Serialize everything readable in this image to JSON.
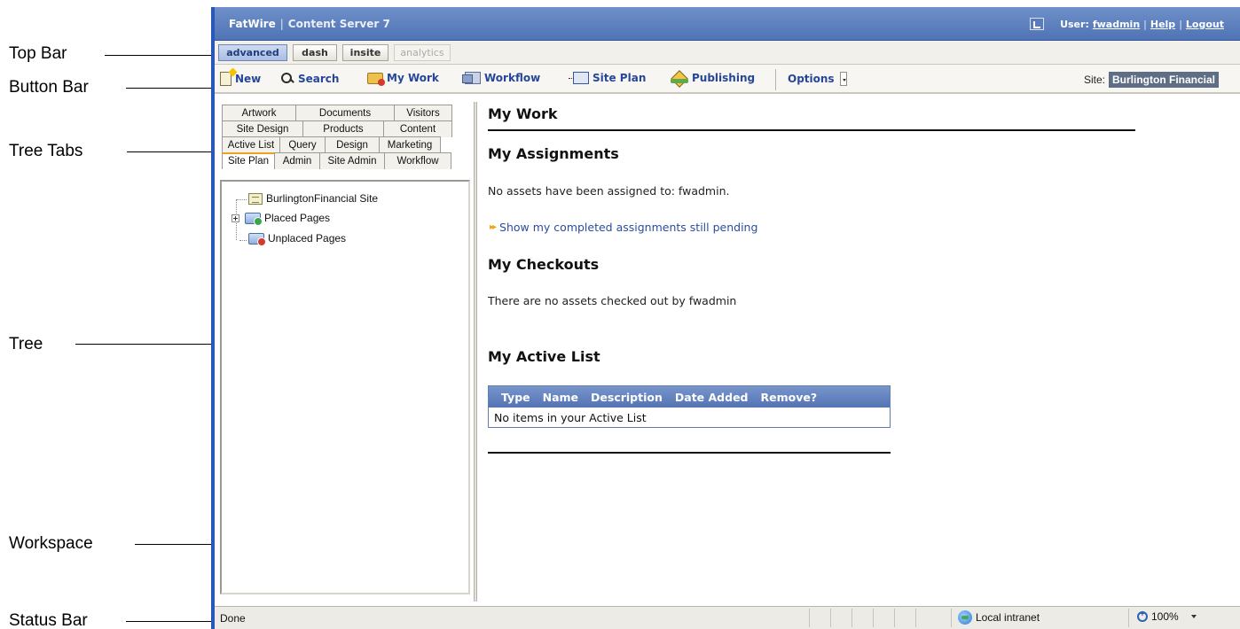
{
  "annotations": {
    "top_bar": "Top Bar",
    "button_bar": "Button Bar",
    "tree_tabs": "Tree Tabs",
    "tree": "Tree",
    "workspace": "Workspace",
    "status_bar": "Status Bar"
  },
  "topbar": {
    "brand": "FatWire",
    "product": "Content Server 7",
    "user_label": "User:",
    "user_name": "fwadmin",
    "help": "Help",
    "logout": "Logout",
    "icon": "exit-panel-icon"
  },
  "modes": {
    "advanced": "advanced",
    "dash": "dash",
    "insite": "insite",
    "analytics": "analytics"
  },
  "buttonbar": {
    "new": "New",
    "search": "Search",
    "my_work": "My Work",
    "workflow": "Workflow",
    "site_plan": "Site Plan",
    "publishing": "Publishing",
    "options": "Options",
    "site_label": "Site:",
    "site_value": "Burlington Financial"
  },
  "tree_tabs": {
    "row1": [
      "Artwork",
      "Documents",
      "Visitors"
    ],
    "row2": [
      "Site Design",
      "Products",
      "Content"
    ],
    "row3": [
      "Active List",
      "Query",
      "Design",
      "Marketing"
    ],
    "row4": [
      "Site Plan",
      "Admin",
      "Site Admin",
      "Workflow"
    ],
    "selected": "Site Plan"
  },
  "tree": {
    "nodes": [
      "BurlingtonFinancial Site",
      "Placed Pages",
      "Unplaced Pages"
    ]
  },
  "workspace": {
    "title": "My Work",
    "assignments_heading": "My Assignments",
    "assignments_text": "No assets have been assigned to: fwadmin.",
    "completed_link": "Show my completed assignments still pending",
    "checkouts_heading": "My Checkouts",
    "checkouts_text": "There are no assets checked out by fwadmin",
    "active_list_heading": "My Active List",
    "active_list_columns": [
      "Type",
      "Name",
      "Description",
      "Date Added",
      "Remove?"
    ],
    "active_list_empty": "No items in your Active List"
  },
  "statusbar": {
    "status": "Done",
    "zone": "Local intranet",
    "zoom": "100%"
  },
  "colors": {
    "topbar": "#5a7cbd",
    "accent_tab": "#f0a020",
    "link": "#2b4e9a",
    "table_header": "#6585c0"
  }
}
